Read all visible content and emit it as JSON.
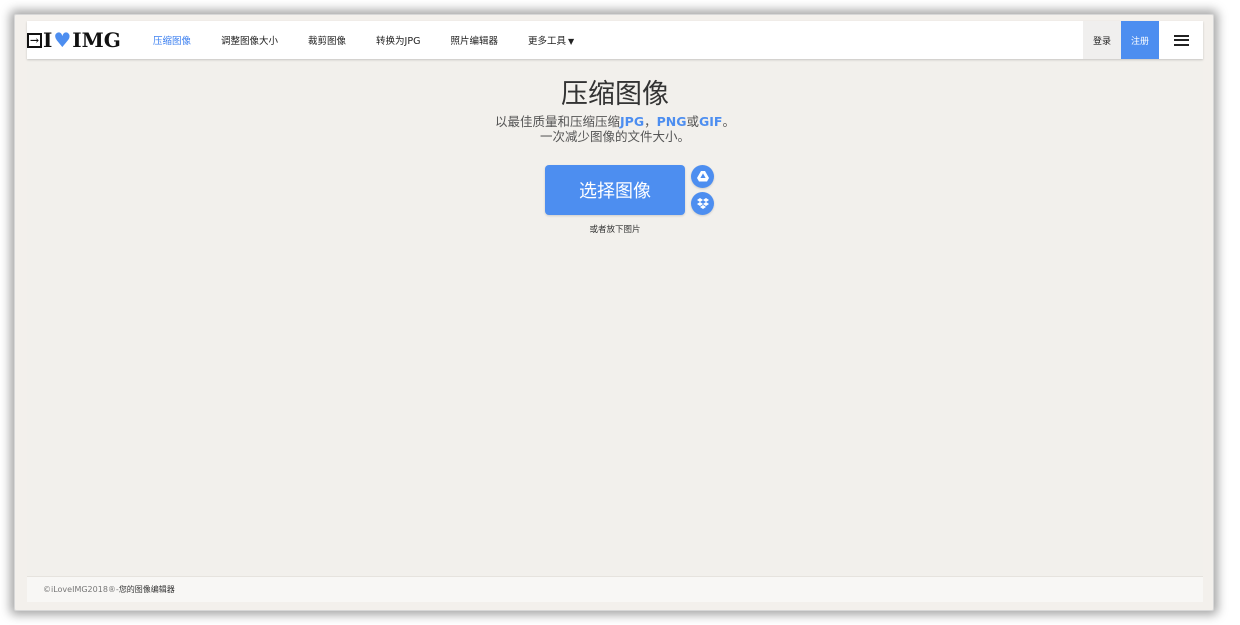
{
  "nav": {
    "logo_text": "I ❤ IMG",
    "items": [
      {
        "label": "压缩图像",
        "active": true
      },
      {
        "label": "调整图像大小",
        "active": false
      },
      {
        "label": "裁剪图像",
        "active": false
      },
      {
        "label": "转换为JPG",
        "active": false
      },
      {
        "label": "照片编辑器",
        "active": false
      },
      {
        "label": "更多工具",
        "active": false,
        "dropdown": true
      }
    ],
    "login_label": "登录",
    "signup_label": "注册",
    "menu_icon": "hamburger-icon"
  },
  "hero": {
    "title": "压缩图像",
    "subtitle_prefix": "以最佳质量和压缩压缩",
    "format_jpg": "JPG",
    "separator": "，",
    "format_png": "PNG",
    "word_or": "或",
    "format_gif": "GIF",
    "period": "。",
    "subtitle_line2": "一次减少图像的文件大小。"
  },
  "upload": {
    "button_label": "选择图像",
    "google_drive_icon": "google-drive-icon",
    "dropbox_icon": "dropbox-icon",
    "drop_hint": "或者放下图片"
  },
  "footer": {
    "copyright": "©iLoveIMG2018®",
    "separator": " - ",
    "tagline": "您的图像编辑器"
  },
  "colors": {
    "accent": "#4d8ef0",
    "background": "#f2f0ec"
  }
}
